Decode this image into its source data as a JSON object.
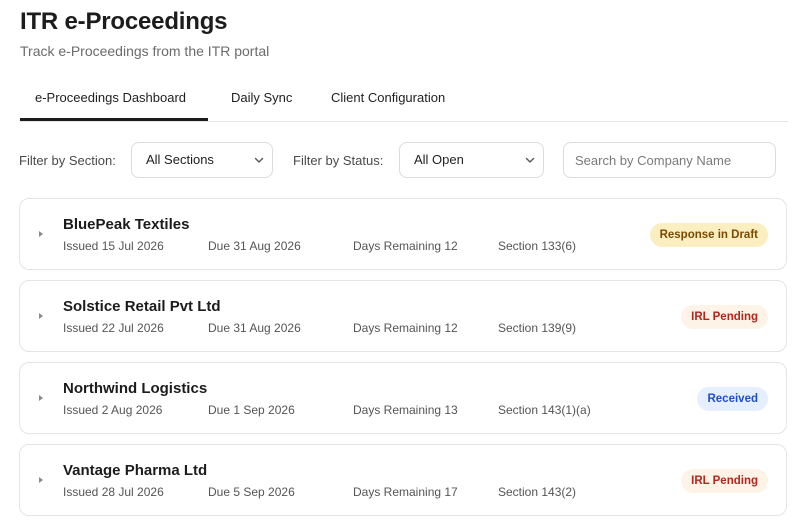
{
  "header": {
    "title": "ITR e-Proceedings",
    "subtitle": "Track e-Proceedings from the ITR portal"
  },
  "tabs": [
    {
      "label": "e-Proceedings Dashboard",
      "active": true
    },
    {
      "label": "Daily Sync",
      "active": false
    },
    {
      "label": "Client Configuration",
      "active": false
    }
  ],
  "filters": {
    "section_label": "Filter by Section:",
    "section_value": "All Sections",
    "status_label": "Filter by Status:",
    "status_value": "All Open",
    "search_placeholder": "Search by Company Name"
  },
  "proceedings": [
    {
      "company": "BluePeak Textiles",
      "issued": "Issued 15 Jul 2026",
      "due": "Due 31 Aug 2026",
      "days": "Days Remaining 12",
      "section": "Section 133(6)",
      "status": "Response in Draft",
      "status_kind": "draft"
    },
    {
      "company": "Solstice Retail Pvt Ltd",
      "issued": "Issued 22 Jul 2026",
      "due": "Due 31 Aug 2026",
      "days": "Days Remaining 12",
      "section": "Section 139(9)",
      "status": "IRL Pending",
      "status_kind": "irl"
    },
    {
      "company": "Northwind Logistics",
      "issued": "Issued 2 Aug 2026",
      "due": "Due 1 Sep 2026",
      "days": "Days Remaining 13",
      "section": "Section 143(1)(a)",
      "status": "Received",
      "status_kind": "received"
    },
    {
      "company": "Vantage Pharma Ltd",
      "issued": "Issued 28 Jul 2026",
      "due": "Due 5 Sep 2026",
      "days": "Days Remaining 17",
      "section": "Section 143(2)",
      "status": "IRL Pending",
      "status_kind": "irl"
    }
  ],
  "icons": {
    "dropdown": "chevron-down-icon",
    "expand": "caret-right-icon"
  },
  "colors": {
    "draft_bg": "#fbeec0",
    "irl_bg": "#fdf3e7",
    "received_bg": "#e6efff"
  }
}
